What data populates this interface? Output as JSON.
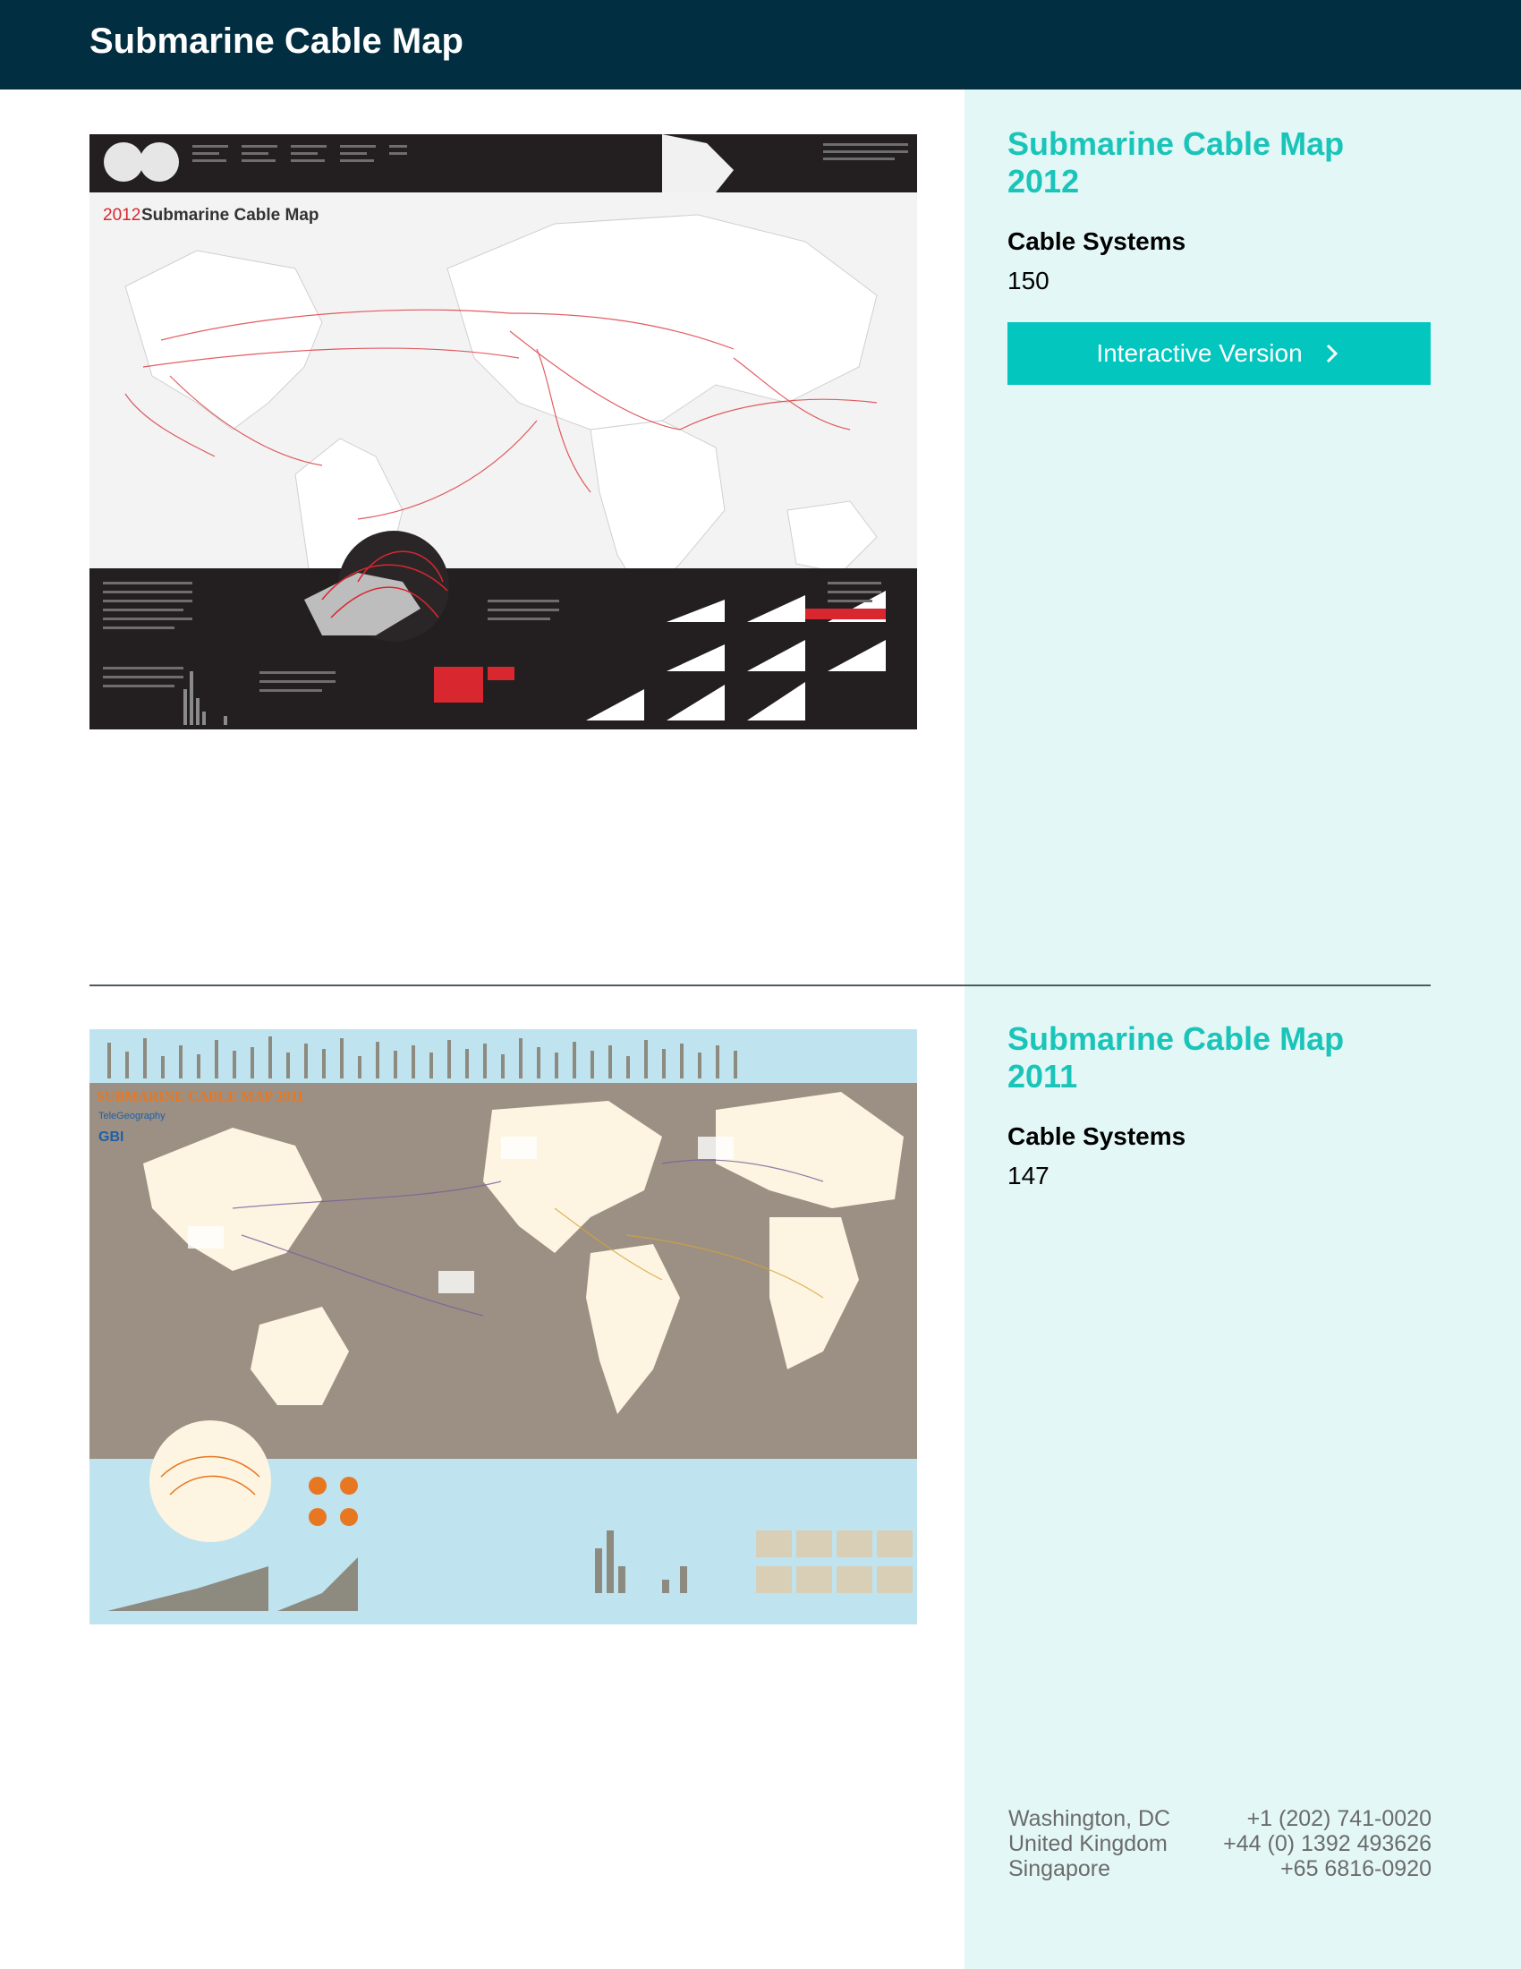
{
  "header": {
    "title": "Submarine Cable Map"
  },
  "maps": [
    {
      "title": "Submarine Cable Map 2012",
      "systems_label": "Cable Systems",
      "systems_count": "150",
      "button_label": "Interactive Version",
      "thumbnail_icon": "world-map-2012-thumbnail",
      "thumbnail_text": {
        "year": "2012",
        "title": "Submarine Cable Map"
      }
    },
    {
      "title": "Submarine Cable Map 2011",
      "systems_label": "Cable Systems",
      "systems_count": "147",
      "thumbnail_icon": "world-map-2011-thumbnail",
      "thumbnail_text": {
        "title": "SUBMARINE CABLE MAP 2011",
        "brand": "TeleGeography",
        "logo": "GBI"
      }
    }
  ],
  "footer": {
    "offices": [
      {
        "location": "Washington, DC",
        "phone": "+1 (202) 741-0020"
      },
      {
        "location": "United Kingdom",
        "phone": "+44 (0) 1392 493626"
      },
      {
        "location": "Singapore",
        "phone": "+65 6816-0920"
      }
    ]
  },
  "colors": {
    "header_bg": "#012e40",
    "sidebar_bg": "#e3f8f6",
    "accent": "#1ac4b9",
    "button_bg": "#03c6bf",
    "divider": "#4d5a5e",
    "footer_text": "#6b6b6b"
  }
}
